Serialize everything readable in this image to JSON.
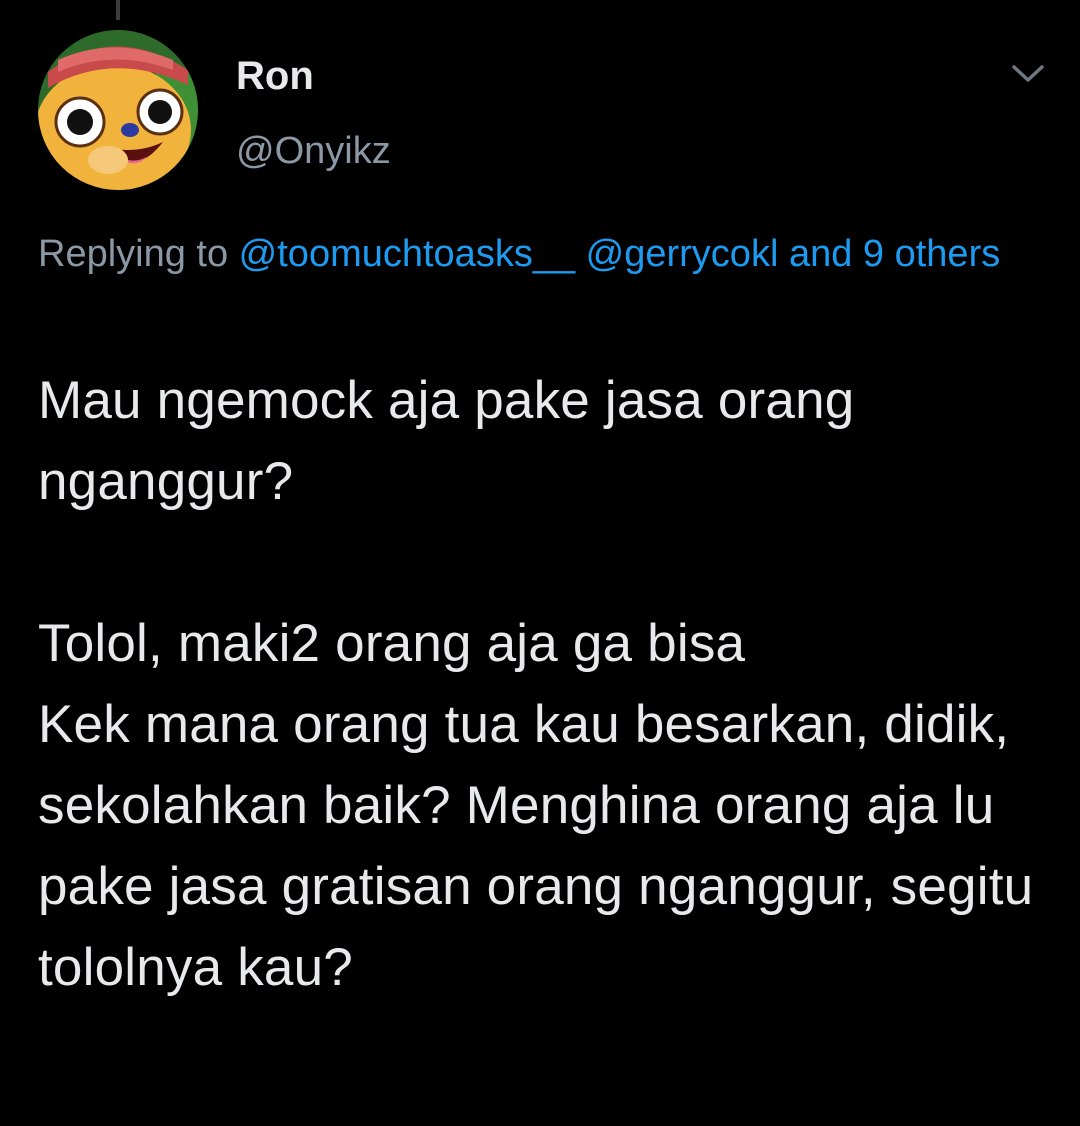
{
  "author": {
    "display_name": "Ron",
    "handle": "@Onyikz",
    "avatar_icon": "cartoon-bear-avatar"
  },
  "reply": {
    "prefix": "Replying to ",
    "mention_1": "@toomuchtoasks__",
    "mention_2": "@gerrycokl",
    "others": "and 9 others"
  },
  "tweet": {
    "paragraph_1": "Mau ngemock aja pake jasa orang nganggur?",
    "paragraph_2": "Tolol, maki2 orang aja ga bisa\nKek mana orang tua kau besarkan, didik, sekolahkan baik? Menghina orang aja lu pake jasa gratisan orang nganggur, segitu tololnya kau?"
  },
  "colors": {
    "background": "#000000",
    "text": "#e7e9ea",
    "secondary": "#8b98a5",
    "link": "#1d9bf0"
  },
  "icons": {
    "more_menu": "chevron-down-icon"
  }
}
